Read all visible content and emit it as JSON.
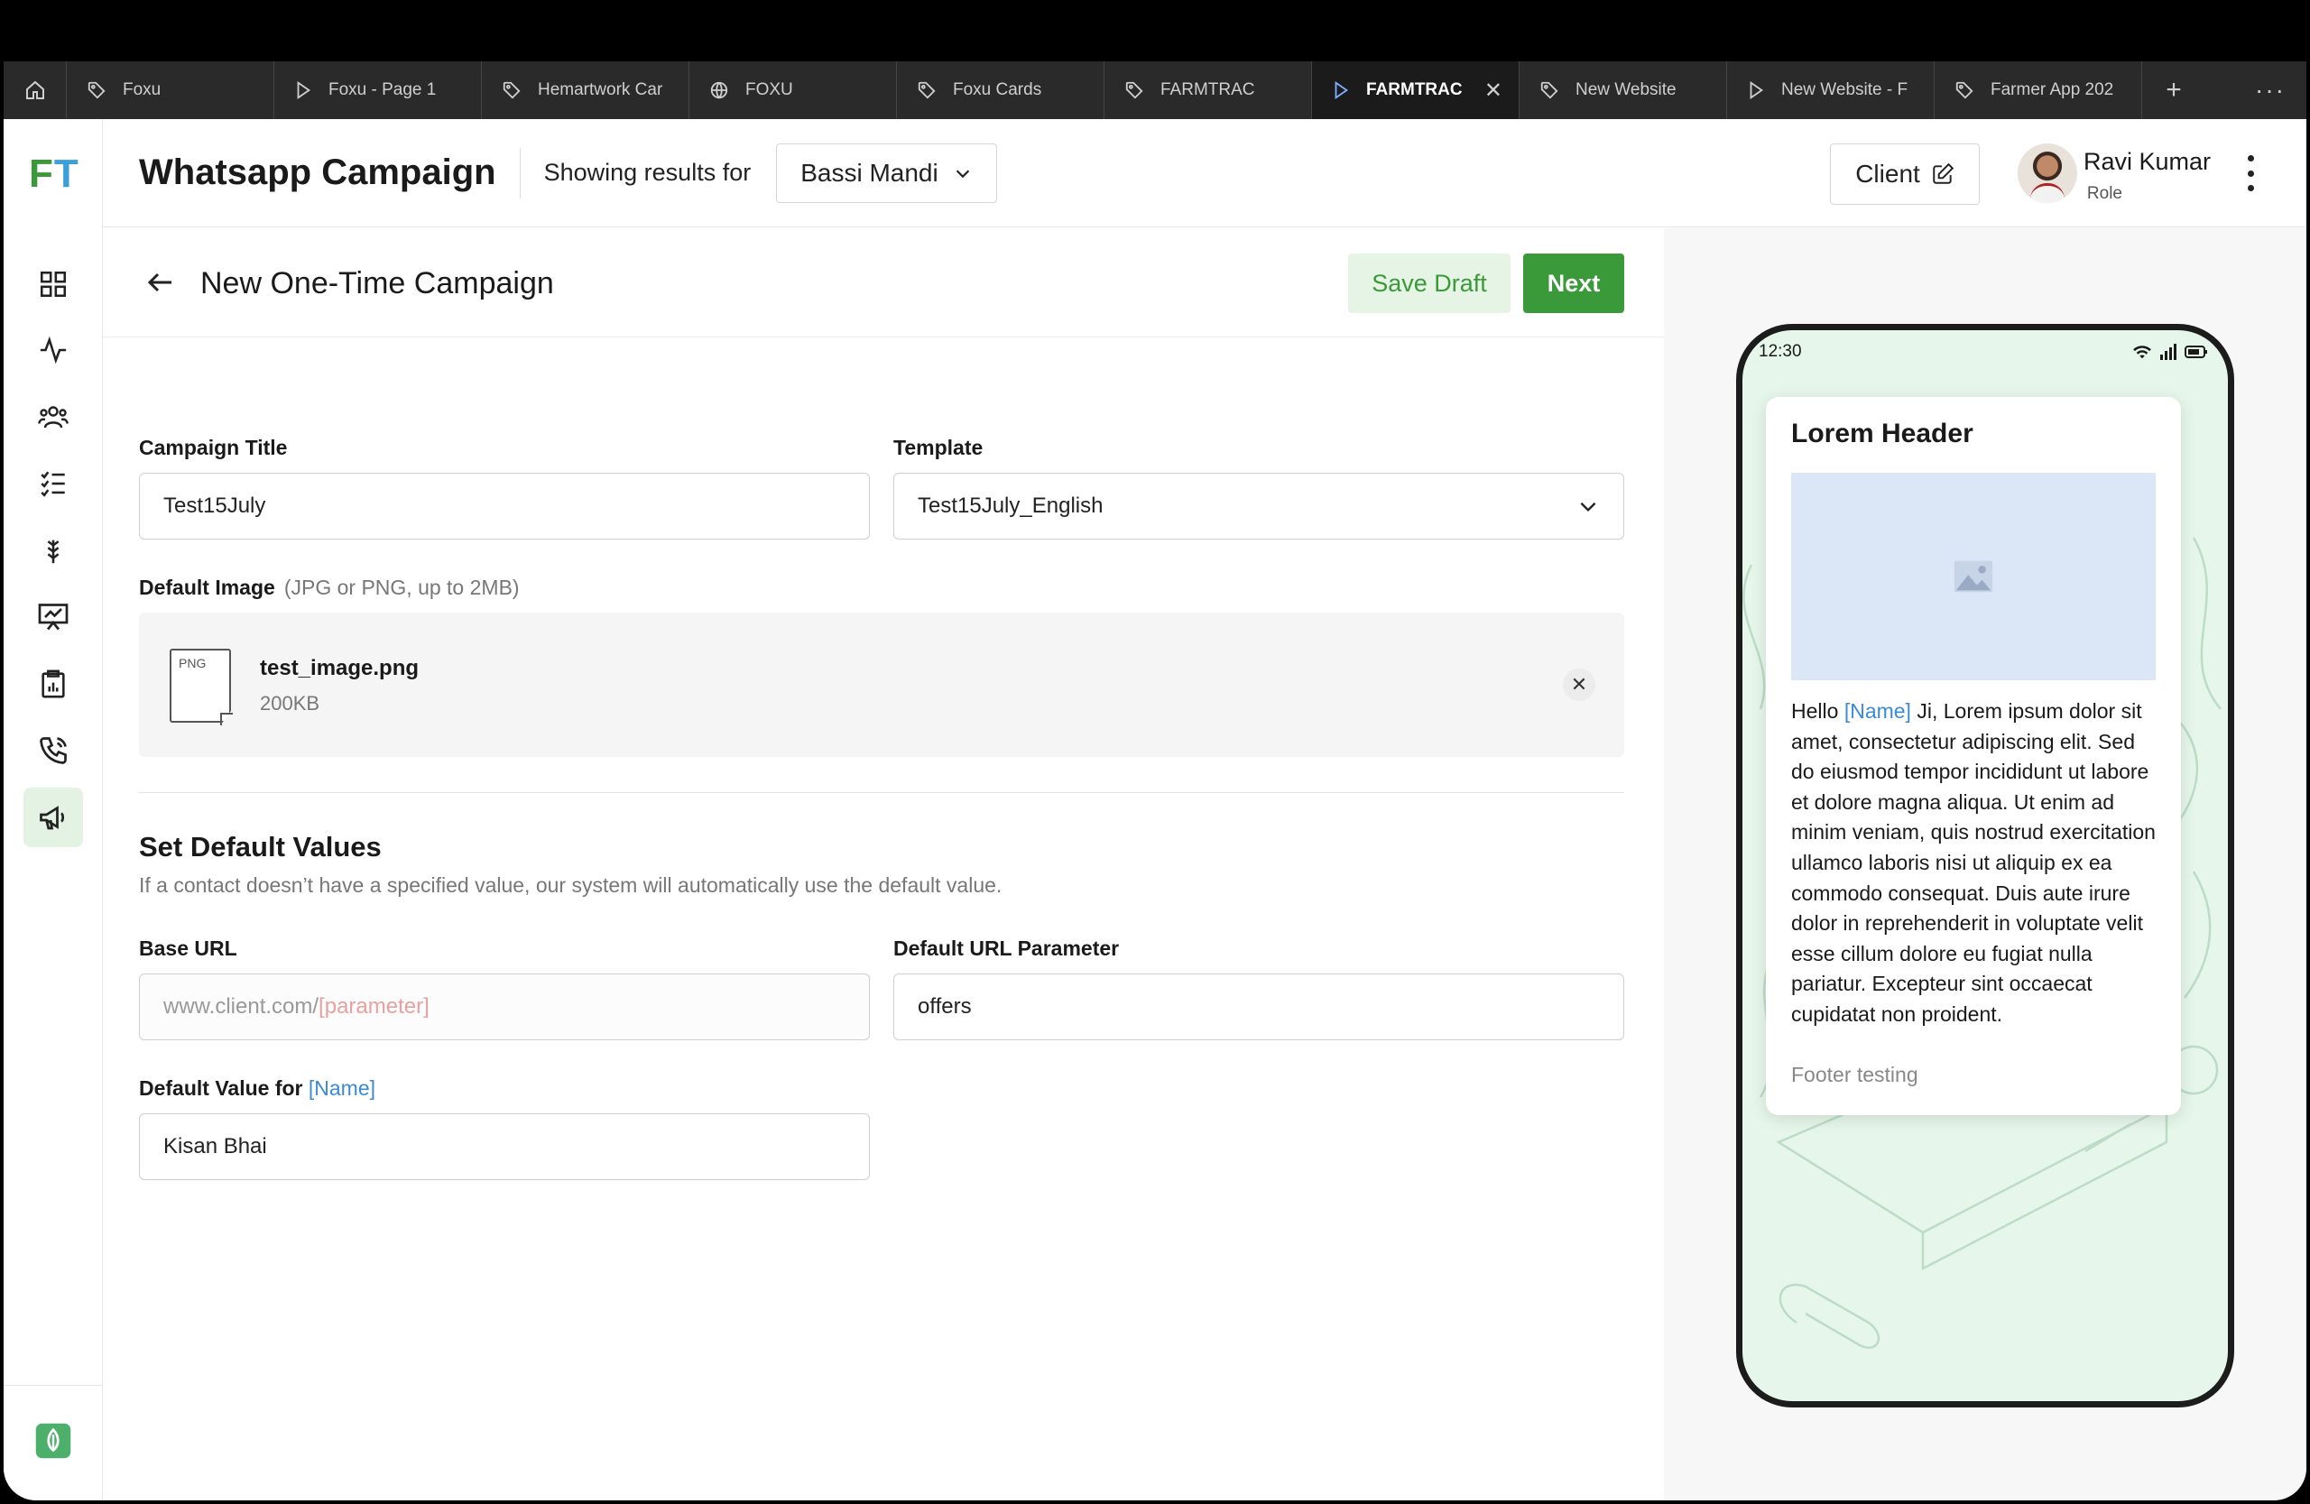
{
  "tabs": [
    {
      "label": "Foxu",
      "icon": "tag-icon"
    },
    {
      "label": "Foxu - Page 1",
      "icon": "play-icon"
    },
    {
      "label": "Hemartwork Car",
      "icon": "tag-icon"
    },
    {
      "label": "FOXU",
      "icon": "globe-icon"
    },
    {
      "label": "Foxu Cards",
      "icon": "tag-icon"
    },
    {
      "label": "FARMTRAC",
      "icon": "tag-icon"
    },
    {
      "label": "FARMTRAC",
      "icon": "play-icon",
      "active": true
    },
    {
      "label": "New Website",
      "icon": "tag-icon"
    },
    {
      "label": "New Website - F",
      "icon": "play-icon"
    },
    {
      "label": "Farmer App 202",
      "icon": "tag-icon"
    }
  ],
  "tab_add": "+",
  "tab_more": "···",
  "tab_close": "✕",
  "logo": {
    "f": "F",
    "t": "T"
  },
  "header": {
    "title": "Whatsapp Campaign",
    "showing_label": "Showing results for",
    "location": "Bassi Mandi",
    "client_button": "Client",
    "user_name": "Ravi Kumar",
    "user_role": "Role"
  },
  "campaign": {
    "title": "New One-Time Campaign",
    "save_draft": "Save Draft",
    "next": "Next"
  },
  "form": {
    "campaign_title_label": "Campaign Title",
    "campaign_title_value": "Test15July",
    "template_label": "Template",
    "template_value": "Test15July_English",
    "default_image_label": "Default Image",
    "default_image_hint": "(JPG or PNG, up to 2MB)",
    "file": {
      "type": "PNG",
      "name": "test_image.png",
      "size": "200KB",
      "remove": "✕"
    },
    "defaults_title": "Set Default Values",
    "defaults_desc": "If a contact doesn’t have a specified value, our system will automatically use the default value.",
    "base_url_label": "Base URL",
    "base_url_placeholder": "www.client.com/",
    "base_url_param": "[parameter]",
    "url_param_label": "Default URL Parameter",
    "url_param_value": "offers",
    "default_name_label": "Default Value for",
    "default_name_var": "[Name]",
    "default_name_value": "Kisan Bhai"
  },
  "preview": {
    "time": "12:30",
    "header": "Lorem Header",
    "body_prefix": "Hello",
    "body_var": "[Name]",
    "body_text": " Ji, Lorem ipsum dolor sit amet, consectetur adipiscing elit. Sed do eiusmod tempor incididunt ut labore et dolore magna aliqua. Ut enim ad minim veniam, quis nostrud exercitation ullamco laboris nisi ut aliquip ex ea commodo consequat. Duis aute irure dolor in reprehenderit in voluptate velit esse cillum dolore eu fugiat nulla pariatur. Excepteur sint occaecat cupidatat non proident.",
    "footer": "Footer testing"
  },
  "colors": {
    "accent_green": "#3a9a3a",
    "accent_blue": "#3a8ad8",
    "tabbar": "#2a2a2a",
    "preview_bg": "#e6f6ea"
  }
}
